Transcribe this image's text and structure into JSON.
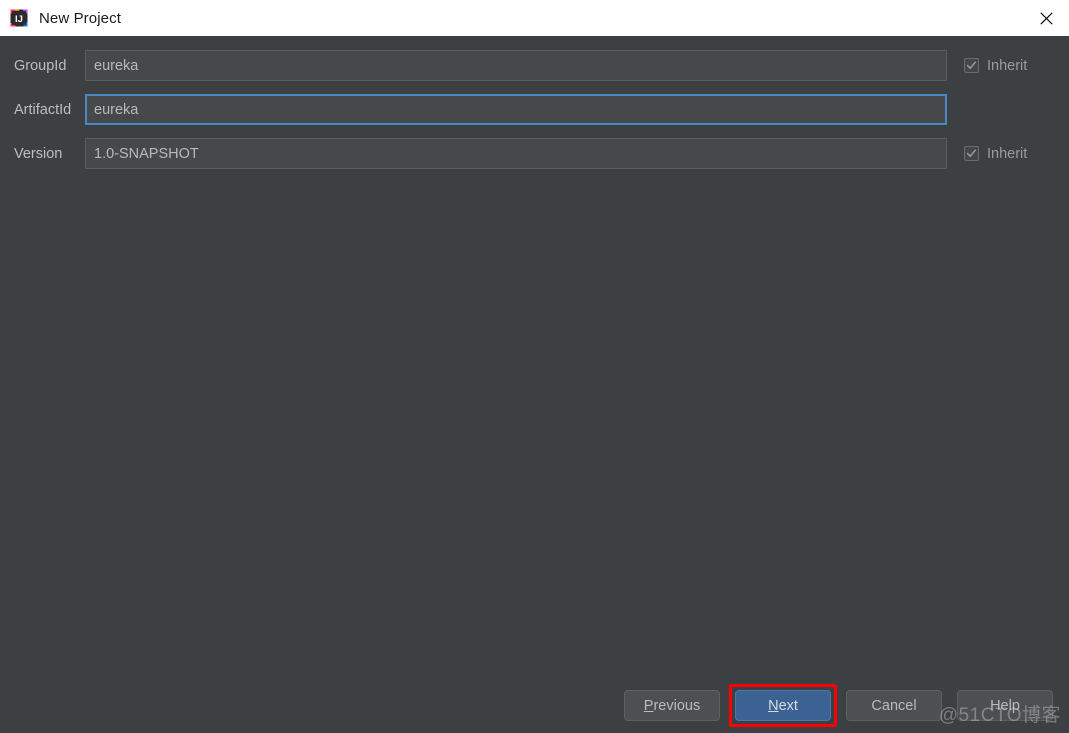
{
  "window": {
    "title": "New Project",
    "app_icon": "intellij-idea-logo-icon",
    "close_icon": "close-icon",
    "background_color": "#3c4043",
    "titlebar_color": "#ffffff"
  },
  "form": {
    "rows": [
      {
        "label": "GroupId",
        "value": "eureka",
        "focused": false,
        "inherit": {
          "label": "Inherit",
          "checked": true,
          "enabled": false
        }
      },
      {
        "label": "ArtifactId",
        "value": "eureka",
        "focused": true,
        "inherit": null
      },
      {
        "label": "Version",
        "value": "1.0-SNAPSHOT",
        "focused": false,
        "inherit": {
          "label": "Inherit",
          "checked": true,
          "enabled": false
        }
      }
    ]
  },
  "buttons": {
    "previous": {
      "label": "Previous",
      "mnemonic": "P",
      "rest": "revious",
      "default": false
    },
    "next": {
      "label": "Next",
      "mnemonic": "N",
      "rest": "ext",
      "default": true,
      "annotated": true
    },
    "cancel": {
      "label": "Cancel",
      "default": false
    },
    "help": {
      "label": "Help",
      "default": false
    }
  },
  "annotation": {
    "color": "#fb0007",
    "target": "next-button"
  },
  "watermark": {
    "text": "@51CTO博客"
  },
  "colors": {
    "accent_focus": "#4b88c6",
    "default_button": "#3b6293",
    "field_background": "#45494a",
    "label_text": "#bdbdbd"
  }
}
